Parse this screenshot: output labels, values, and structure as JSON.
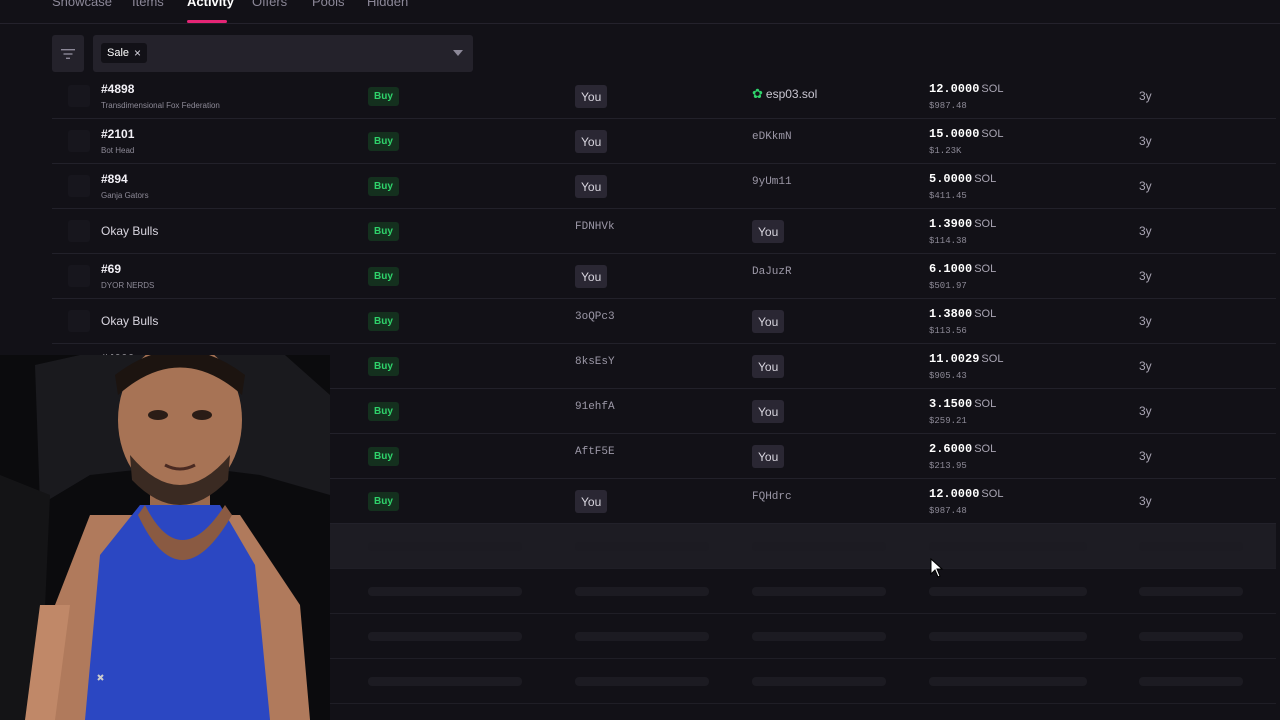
{
  "tabs": [
    {
      "label": "Showcase"
    },
    {
      "label": "Items"
    },
    {
      "label": "Activity"
    },
    {
      "label": "Offers"
    },
    {
      "label": "Pools"
    },
    {
      "label": "Hidden"
    }
  ],
  "filter": {
    "chip_label": "Sale",
    "chip_remove": "×"
  },
  "rows": [
    {
      "name": "#4898",
      "collection": "Transdimensional Fox Federation",
      "type": "Buy",
      "buyer": "You",
      "seller": "esp03.sol",
      "price_sol": "12.0000",
      "unit": "SOL",
      "price_usd": "$987.48",
      "time": "3y"
    },
    {
      "name": "#2101",
      "collection": "Bot Head",
      "type": "Buy",
      "buyer": "You",
      "seller": "eDKkmN",
      "price_sol": "15.0000",
      "unit": "SOL",
      "price_usd": "$1.23K",
      "time": "3y"
    },
    {
      "name": "#894",
      "collection": "Ganja Gators",
      "type": "Buy",
      "buyer": "You",
      "seller": "9yUm11",
      "price_sol": "5.0000",
      "unit": "SOL",
      "price_usd": "$411.45",
      "time": "3y"
    },
    {
      "name": "Okay Bulls",
      "collection": "",
      "type": "Buy",
      "buyer": "FDNHVk",
      "seller": "You",
      "price_sol": "1.3900",
      "unit": "SOL",
      "price_usd": "$114.38",
      "time": "3y"
    },
    {
      "name": "#69",
      "collection": "DYOR NERDS",
      "type": "Buy",
      "buyer": "You",
      "seller": "DaJuzR",
      "price_sol": "6.1000",
      "unit": "SOL",
      "price_usd": "$501.97",
      "time": "3y"
    },
    {
      "name": "Okay Bulls",
      "collection": "",
      "type": "Buy",
      "buyer": "3oQPc3",
      "seller": "You",
      "price_sol": "1.3800",
      "unit": "SOL",
      "price_usd": "$113.56",
      "time": "3y"
    },
    {
      "name": "#4888",
      "collection": "",
      "type": "Buy",
      "buyer": "8ksEsY",
      "seller": "You",
      "price_sol": "11.0029",
      "unit": "SOL",
      "price_usd": "$905.43",
      "time": "3y"
    },
    {
      "name": "",
      "collection": "",
      "type": "Buy",
      "buyer": "91ehfA",
      "seller": "You",
      "price_sol": "3.1500",
      "unit": "SOL",
      "price_usd": "$259.21",
      "time": "3y"
    },
    {
      "name": "",
      "collection": "",
      "type": "Buy",
      "buyer": "AftF5E",
      "seller": "You",
      "price_sol": "2.6000",
      "unit": "SOL",
      "price_usd": "$213.95",
      "time": "3y"
    },
    {
      "name": "",
      "collection": "",
      "type": "Buy",
      "buyer": "You",
      "seller": "FQHdrc",
      "price_sol": "12.0000",
      "unit": "SOL",
      "price_usd": "$987.48",
      "time": "3y"
    }
  ],
  "icons": {
    "filter": "filter-lines-icon",
    "caret": "chevron-down-icon",
    "verified": "gear-badge-icon",
    "cursor": "mouse-pointer-icon"
  },
  "colors": {
    "accent": "#e42575",
    "buy_green": "#2fd36b",
    "background": "#121117"
  }
}
